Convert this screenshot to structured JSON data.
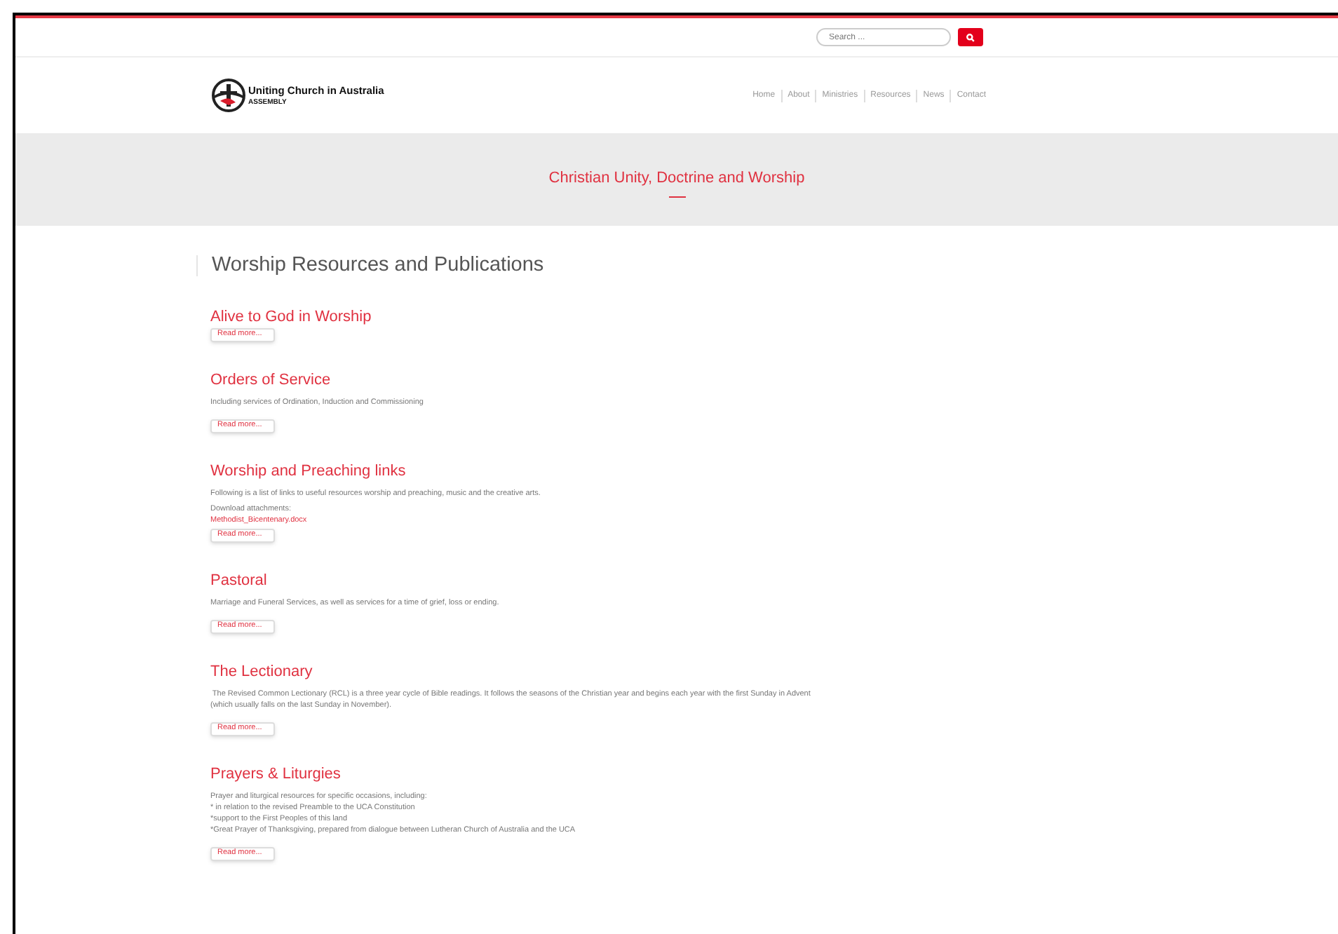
{
  "search": {
    "placeholder": "Search ..."
  },
  "logo": {
    "name": "Uniting Church in Australia",
    "sub": "ASSEMBLY"
  },
  "nav": [
    "Home",
    "About",
    "Ministries",
    "Resources",
    "News",
    "Contact"
  ],
  "banner": {
    "title": "Christian Unity, Doctrine and Worship"
  },
  "page_title": "Worship Resources and Publications",
  "sections": [
    {
      "title": "Alive to God in Worship",
      "button": "Read more..."
    },
    {
      "title": "Orders of Service",
      "description": [
        "Including services of Ordination, Induction and Commissioning"
      ],
      "button": "Read more..."
    },
    {
      "title": "Worship and Preaching links",
      "description": [
        "Following is a list of links to useful resources worship and preaching, music and the creative arts."
      ],
      "attachments_label": "Download attachments:",
      "attachment": "Methodist_Bicentenary.docx",
      "button": "Read more..."
    },
    {
      "title": "Pastoral",
      "description": [
        "Marriage and Funeral Services, as well as services for a time of grief, loss or ending."
      ],
      "button": "Read more..."
    },
    {
      "title": "The Lectionary",
      "description": [
        " The Revised Common Lectionary (RCL) is a three year cycle of Bible readings. It follows the seasons of the Christian year and begins each year with the first Sunday in Advent",
        "(which usually falls on the last Sunday in November)."
      ],
      "button": "Read more..."
    },
    {
      "title": "Prayers & Liturgies",
      "description": [
        "Prayer and liturgical resources for specific occasions, including:",
        "* in relation to the revised Preamble to the UCA Constitution",
        "*support to the First Peoples of this land",
        "*Great Prayer of Thanksgiving, prepared from dialogue between Lutheran Church of Australia and the UCA"
      ],
      "button": "Read more..."
    }
  ]
}
